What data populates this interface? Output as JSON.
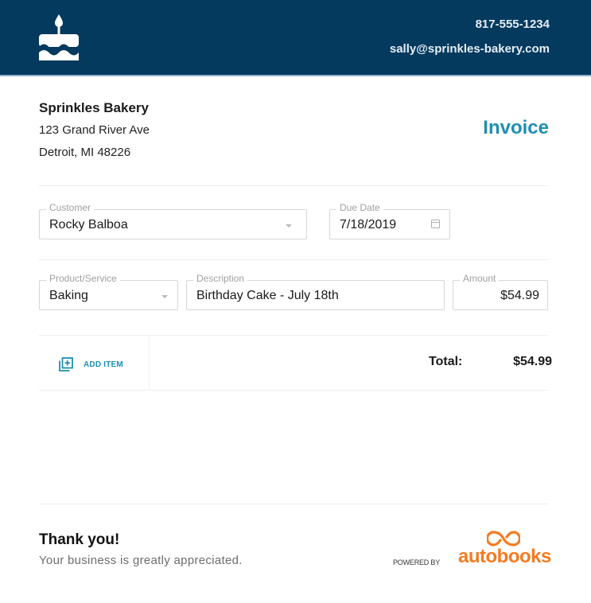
{
  "header": {
    "logo_icon": "birthday-cake-icon",
    "phone": "817-555-1234",
    "email": "sally@sprinkles-bakery.com",
    "background_color": "#053a5f"
  },
  "business": {
    "name": "Sprinkles Bakery",
    "address_line1": "123 Grand River Ave",
    "address_line2": "Detroit, MI 48226"
  },
  "document_title": "Invoice",
  "accent_color": "#1e8fb1",
  "customer_field": {
    "label": "Customer",
    "value": "Rocky Balboa",
    "icon": "chevron-down-icon"
  },
  "due_date_field": {
    "label": "Due Date",
    "value": "7/18/2019",
    "icon": "calendar-icon"
  },
  "line_items": [
    {
      "product": {
        "label": "Product/Service",
        "value": "Baking",
        "icon": "chevron-down-icon"
      },
      "description": {
        "label": "Description",
        "value": "Birthday Cake - July 18th"
      },
      "amount": {
        "label": "Amount",
        "value": "$54.99"
      }
    }
  ],
  "add_item": {
    "label": "ADD ITEM",
    "icon": "add-item-icon"
  },
  "totals": {
    "label": "Total:",
    "value": "$54.99"
  },
  "footer": {
    "thanks_title": "Thank you!",
    "thanks_message": "Your business is greatly appreciated.",
    "powered_by": "POWERED BY",
    "brand_name": "autobooks",
    "brand_color": "#f47b20"
  }
}
